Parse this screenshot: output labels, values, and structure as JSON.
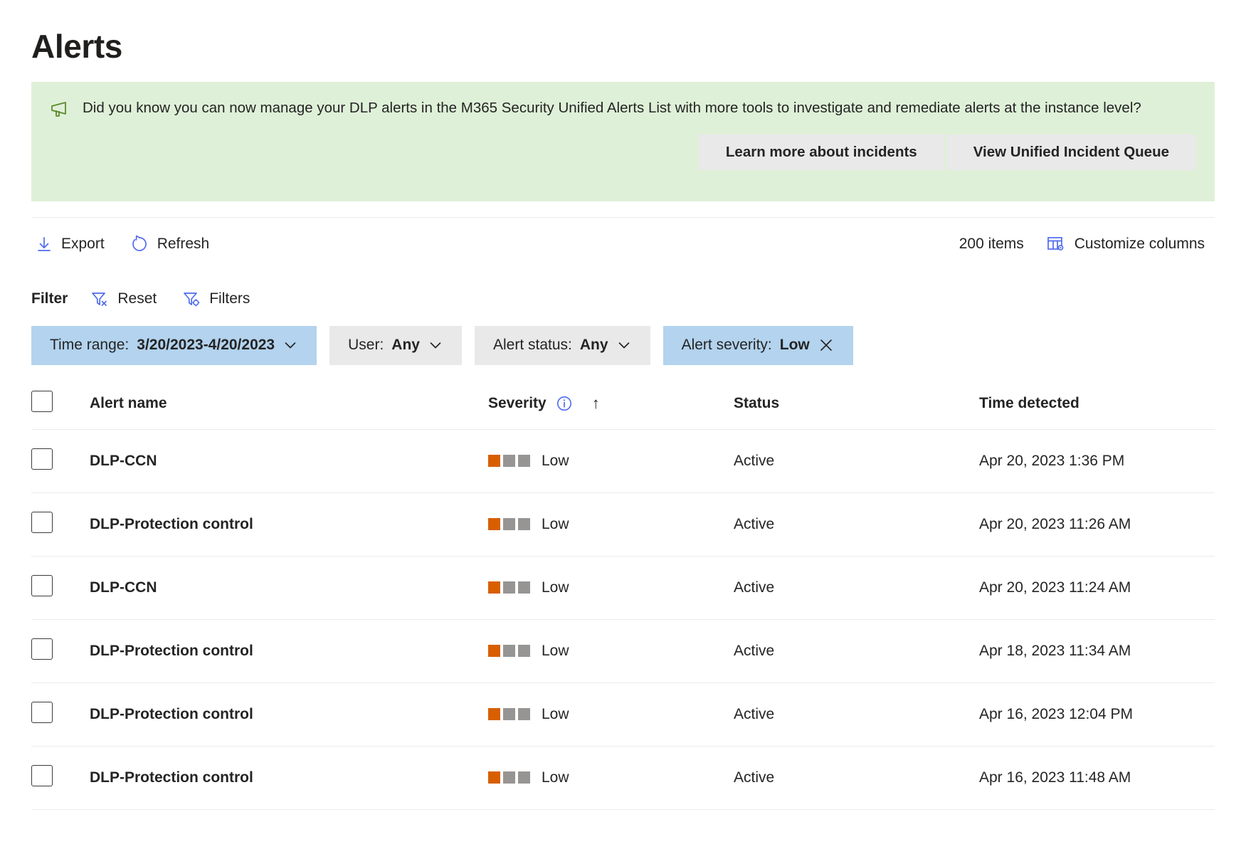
{
  "header": {
    "title": "Alerts"
  },
  "banner": {
    "icon": "megaphone-icon",
    "message": "Did you know you can now manage your DLP alerts in the M365 Security Unified Alerts List with more tools to investigate and remediate alerts at the instance level?",
    "learn_more_label": "Learn more about incidents",
    "view_queue_label": "View Unified Incident Queue",
    "background_color": "#dff0d8",
    "icon_color": "#5a8a2d"
  },
  "commandbar": {
    "export_label": "Export",
    "refresh_label": "Refresh",
    "item_count": "200 items",
    "customize_columns_label": "Customize columns",
    "accent_color": "#4f6bed"
  },
  "filterbar": {
    "label": "Filter",
    "reset_label": "Reset",
    "filters_label": "Filters"
  },
  "pills": [
    {
      "key": "Time range:",
      "value": "3/20/2023-4/20/2023",
      "style": "blue",
      "affordance": "chevron-down"
    },
    {
      "key": "User:",
      "value": "Any",
      "style": "gray",
      "affordance": "chevron-down"
    },
    {
      "key": "Alert status:",
      "value": "Any",
      "style": "gray",
      "affordance": "chevron-down"
    },
    {
      "key": "Alert severity:",
      "value": "Low",
      "style": "blue",
      "affordance": "close"
    }
  ],
  "table": {
    "columns": {
      "select_all": "",
      "alert_name": "Alert name",
      "severity": "Severity",
      "status": "Status",
      "time_detected": "Time detected"
    },
    "sort": {
      "column": "Severity",
      "direction": "ascending",
      "glyph": "↑"
    },
    "severity_colors": {
      "on": "#d75f00",
      "off": "#979593"
    },
    "rows": [
      {
        "name": "DLP-CCN",
        "severity": "Low",
        "severity_level": 1,
        "status": "Active",
        "time": "Apr 20, 2023 1:36 PM"
      },
      {
        "name": "DLP-Protection control",
        "severity": "Low",
        "severity_level": 1,
        "status": "Active",
        "time": "Apr 20, 2023 11:26 AM"
      },
      {
        "name": "DLP-CCN",
        "severity": "Low",
        "severity_level": 1,
        "status": "Active",
        "time": "Apr 20, 2023 11:24 AM"
      },
      {
        "name": "DLP-Protection control",
        "severity": "Low",
        "severity_level": 1,
        "status": "Active",
        "time": "Apr 18, 2023 11:34 AM"
      },
      {
        "name": "DLP-Protection control",
        "severity": "Low",
        "severity_level": 1,
        "status": "Active",
        "time": "Apr 16, 2023 12:04 PM"
      },
      {
        "name": "DLP-Protection control",
        "severity": "Low",
        "severity_level": 1,
        "status": "Active",
        "time": "Apr 16, 2023 11:48 AM"
      }
    ]
  }
}
